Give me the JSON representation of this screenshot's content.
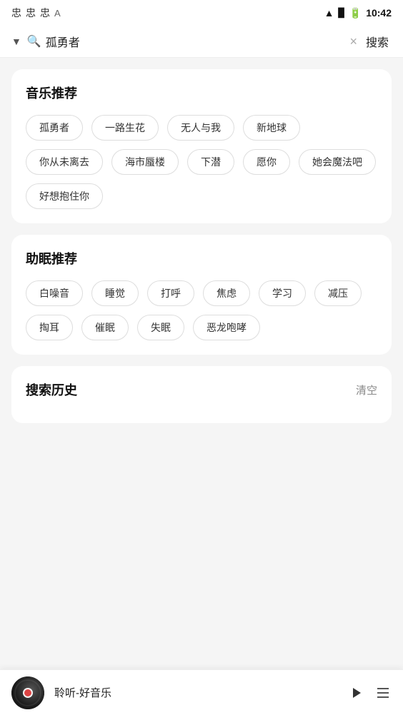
{
  "statusBar": {
    "icons": [
      "忠",
      "忠",
      "忠"
    ],
    "settingsIcon": "A",
    "time": "10:42"
  },
  "searchBar": {
    "dropdownArrow": "▼",
    "searchIcon": "🔍",
    "inputValue": "孤勇者",
    "clearIcon": "×",
    "searchBtn": "搜索"
  },
  "musicSection": {
    "title": "音乐推荐",
    "tags": [
      "孤勇者",
      "一路生花",
      "无人与我",
      "新地球",
      "你从未离去",
      "海市蜃楼",
      "下潜",
      "愿你",
      "她会魔法吧",
      "好想抱住你"
    ]
  },
  "sleepSection": {
    "title": "助眠推荐",
    "tags": [
      "白噪音",
      "睡觉",
      "打呼",
      "焦虑",
      "学习",
      "减压",
      "掏耳",
      "催眠",
      "失眠",
      "恶龙咆哮"
    ]
  },
  "historySection": {
    "title": "搜索历史",
    "clearLabel": "清空"
  },
  "playerBar": {
    "title": "聆听-好音乐",
    "playIcon": "▶",
    "listIcon": "☰"
  }
}
